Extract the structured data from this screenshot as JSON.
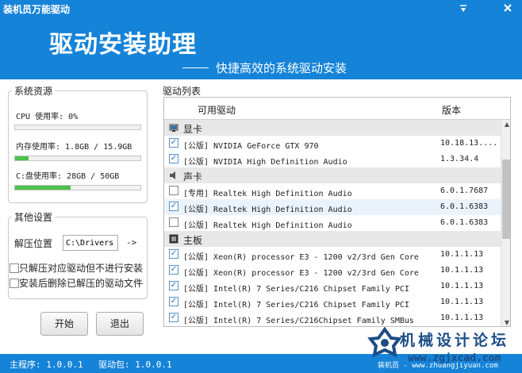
{
  "window": {
    "title": "装机员万能驱动"
  },
  "banner": {
    "title": "驱动安装助理",
    "subtitle": "快捷高效的系统驱动安装"
  },
  "system": {
    "legend": "系统资源",
    "cpu_label": "CPU 使用率: 0%",
    "cpu_fraction": 0.0,
    "mem_label": "内存使用率: 1.8GB / 15.9GB",
    "mem_fraction": 0.11,
    "disk_label": "C:盘使用率: 28GB / 50GB",
    "disk_fraction": 0.44
  },
  "settings": {
    "legend": "其他设置",
    "extract_label": "解压位置",
    "extract_path": "C:\\Drivers",
    "browse_label": "->",
    "opt1": "只解压对应驱动但不进行安装",
    "opt2": "安装后删除已解压的驱动文件"
  },
  "buttons": {
    "start": "开始",
    "exit": "退出"
  },
  "list": {
    "legend": "驱动列表",
    "col_driver": "可用驱动",
    "col_version": "版本",
    "rows": [
      {
        "type": "category",
        "icon": "display-icon",
        "name": "显卡"
      },
      {
        "type": "driver",
        "checked": true,
        "name": "[公版] NVIDIA GeForce GTX 970",
        "version": "10.18.13...."
      },
      {
        "type": "driver",
        "checked": true,
        "name": "[公版] NVIDIA High Definition Audio",
        "version": "1.3.34.4"
      },
      {
        "type": "category",
        "icon": "speaker-icon",
        "name": "声卡"
      },
      {
        "type": "driver",
        "checked": false,
        "name": "[专用] Realtek High Definition Audio",
        "version": "6.0.1.7687"
      },
      {
        "type": "driver",
        "checked": true,
        "selected": true,
        "name": "[公版] Realtek High Definition Audio",
        "version": "6.0.1.6383"
      },
      {
        "type": "driver",
        "checked": false,
        "name": "[公版] Realtek High Definition Audio",
        "version": "6.0.1.6383"
      },
      {
        "type": "category",
        "icon": "motherboard-icon",
        "name": "主板"
      },
      {
        "type": "driver",
        "checked": true,
        "name": "[公版] Xeon(R) processor E3 - 1200 v2/3rd Gen Core",
        "version": "10.1.1.13"
      },
      {
        "type": "driver",
        "checked": true,
        "name": "[公版] Xeon(R) processor E3 - 1200 v2/3rd Gen Core",
        "version": "10.1.1.13"
      },
      {
        "type": "driver",
        "checked": true,
        "name": "[公版] Intel(R) 7 Series/C216 Chipset Family PCI",
        "version": "10.1.1.13"
      },
      {
        "type": "driver",
        "checked": true,
        "name": "[公版] Intel(R) 7 Series/C216 Chipset Family PCI",
        "version": "10.1.1.13"
      },
      {
        "type": "driver",
        "checked": true,
        "name": "[公版] Intel(R) 7 Series/C216Chipset Family SMBus",
        "version": "10.1.1.13"
      }
    ]
  },
  "status": {
    "main_program": "主程序: 1.0.0.1",
    "driver_pack": "驱动包: 1.0.0.1",
    "right_text": "装机员 - www.zhuangjiyuan.com"
  },
  "watermark": {
    "text": "机械设计论坛",
    "url": "www.zgjxcad.com"
  }
}
